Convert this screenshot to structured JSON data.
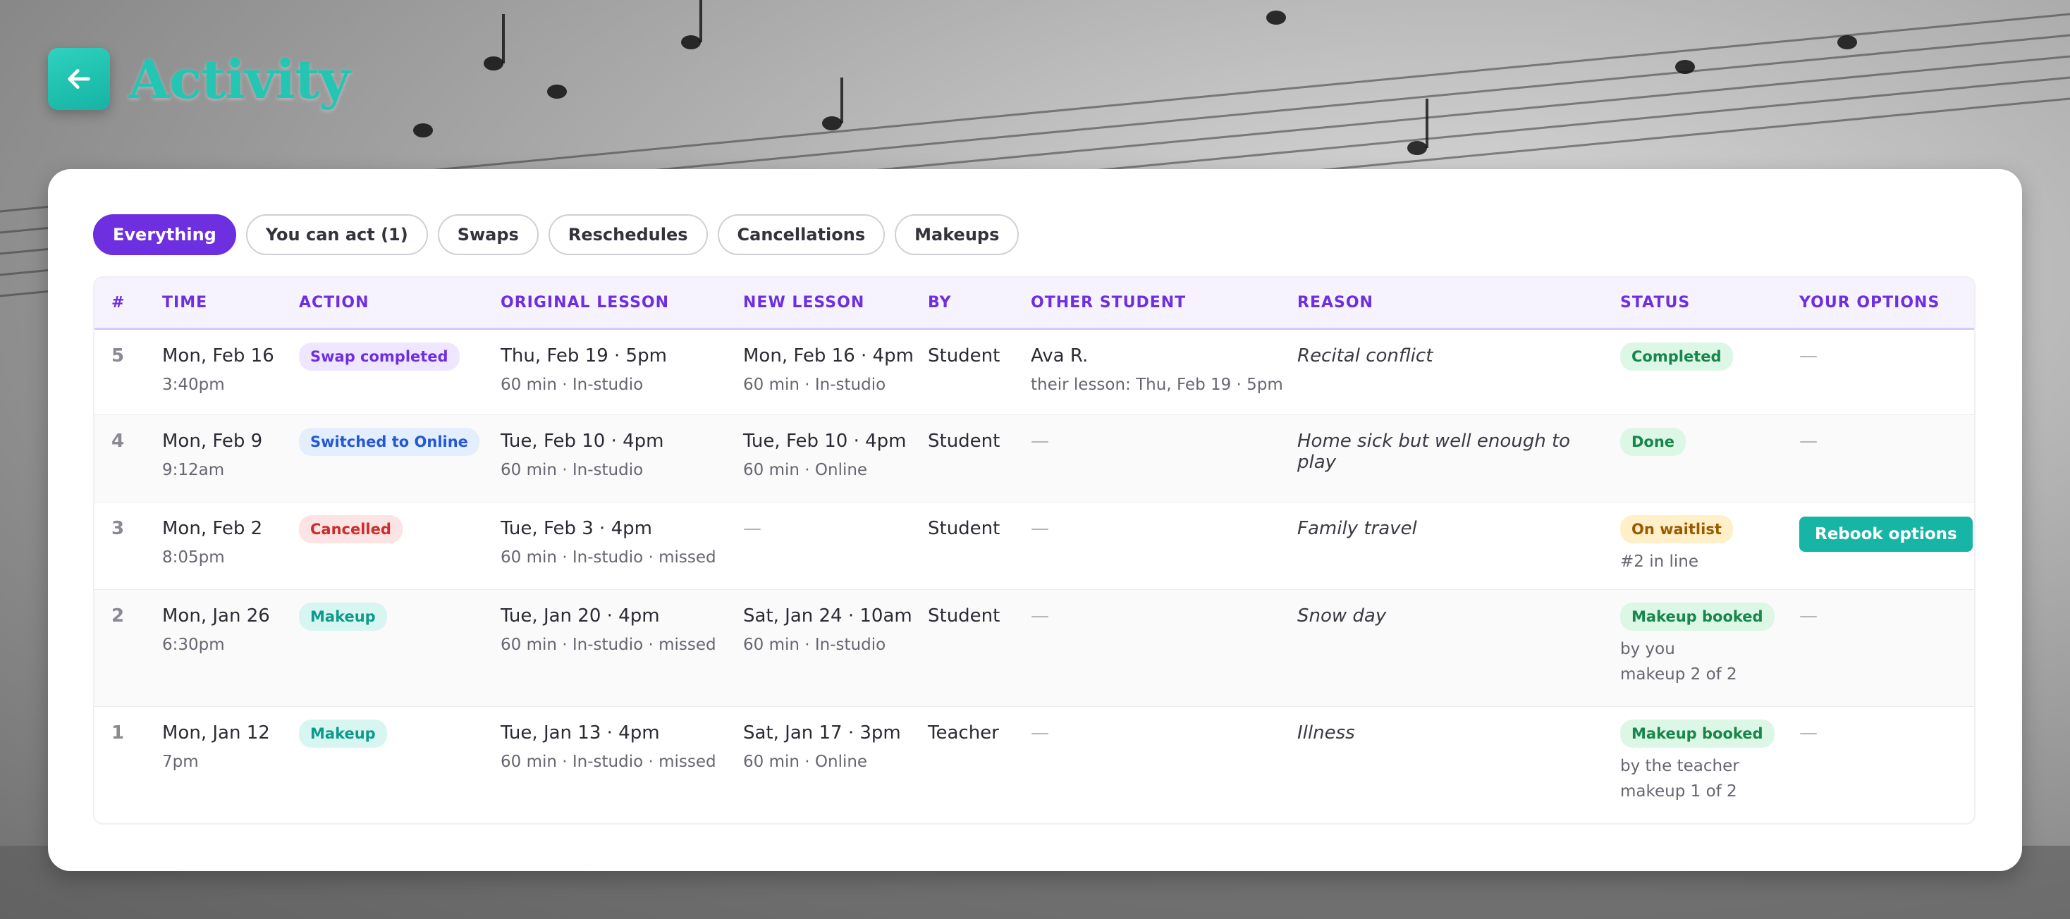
{
  "header": {
    "title": "Activity",
    "back_icon": "arrow-left-icon"
  },
  "filters": [
    "Everything",
    "You can act (1)",
    "Swaps",
    "Reschedules",
    "Cancellations",
    "Makeups"
  ],
  "active_filter": "Everything",
  "columns": [
    "#",
    "TIME",
    "ACTION",
    "ORIGINAL LESSON",
    "NEW LESSON",
    "BY",
    "OTHER STUDENT",
    "REASON",
    "STATUS",
    "YOUR OPTIONS"
  ],
  "rows": [
    {
      "num": "5",
      "time": {
        "date": "Mon, Feb 16",
        "clock": "3:40pm"
      },
      "action": "Swap completed",
      "original": {
        "main": "Thu, Feb 19 · 5pm",
        "sub": "60 min · In-studio"
      },
      "new": {
        "main": "Mon, Feb 16 · 4pm",
        "sub": "60 min · In-studio"
      },
      "by": "Student",
      "other": {
        "main": "Ava R.",
        "sub": "their lesson: Thu, Feb 19 · 5pm"
      },
      "reason": "Recital conflict",
      "status": {
        "label": "Completed",
        "line1": "",
        "line2": ""
      },
      "options": "—"
    },
    {
      "num": "4",
      "time": {
        "date": "Mon, Feb 9",
        "clock": "9:12am"
      },
      "action": "Switched to Online",
      "original": {
        "main": "Tue, Feb 10 · 4pm",
        "sub": "60 min · In-studio"
      },
      "new": {
        "main": "Tue, Feb 10 · 4pm",
        "sub": "60 min · Online"
      },
      "by": "Student",
      "other": {
        "main": "—",
        "sub": ""
      },
      "reason": "Home sick but well enough to play",
      "status": {
        "label": "Done",
        "line1": "",
        "line2": ""
      },
      "options": "—"
    },
    {
      "num": "3",
      "time": {
        "date": "Mon, Feb 2",
        "clock": "8:05pm"
      },
      "action": "Cancelled",
      "original": {
        "main": "Tue, Feb 3 · 4pm",
        "sub": "60 min · In-studio · missed"
      },
      "new": {
        "main": "—",
        "sub": ""
      },
      "by": "Student",
      "other": {
        "main": "—",
        "sub": ""
      },
      "reason": "Family travel",
      "status": {
        "label": "On waitlist",
        "line1": "#2 in line",
        "line2": ""
      },
      "options": "Rebook options"
    },
    {
      "num": "2",
      "time": {
        "date": "Mon, Jan 26",
        "clock": "6:30pm"
      },
      "action": "Makeup",
      "original": {
        "main": "Tue, Jan 20 · 4pm",
        "sub": "60 min · In-studio · missed"
      },
      "new": {
        "main": "Sat, Jan 24 · 10am",
        "sub": "60 min · In-studio"
      },
      "by": "Student",
      "other": {
        "main": "—",
        "sub": ""
      },
      "reason": "Snow day",
      "status": {
        "label": "Makeup booked",
        "line1": "by you",
        "line2": "makeup 2 of 2"
      },
      "options": "—"
    },
    {
      "num": "1",
      "time": {
        "date": "Mon, Jan 12",
        "clock": "7pm"
      },
      "action": "Makeup",
      "original": {
        "main": "Tue, Jan 13 · 4pm",
        "sub": "60 min · In-studio · missed"
      },
      "new": {
        "main": "Sat, Jan 17 · 3pm",
        "sub": "60 min · Online"
      },
      "by": "Teacher",
      "other": {
        "main": "—",
        "sub": ""
      },
      "reason": "Illness",
      "status": {
        "label": "Makeup booked",
        "line1": "by the teacher",
        "line2": "makeup 1 of 2"
      },
      "options": "—"
    }
  ],
  "colors": {
    "accent": "#6d2fe0",
    "teal": "#17b5a5",
    "title": "#24c6b3"
  }
}
